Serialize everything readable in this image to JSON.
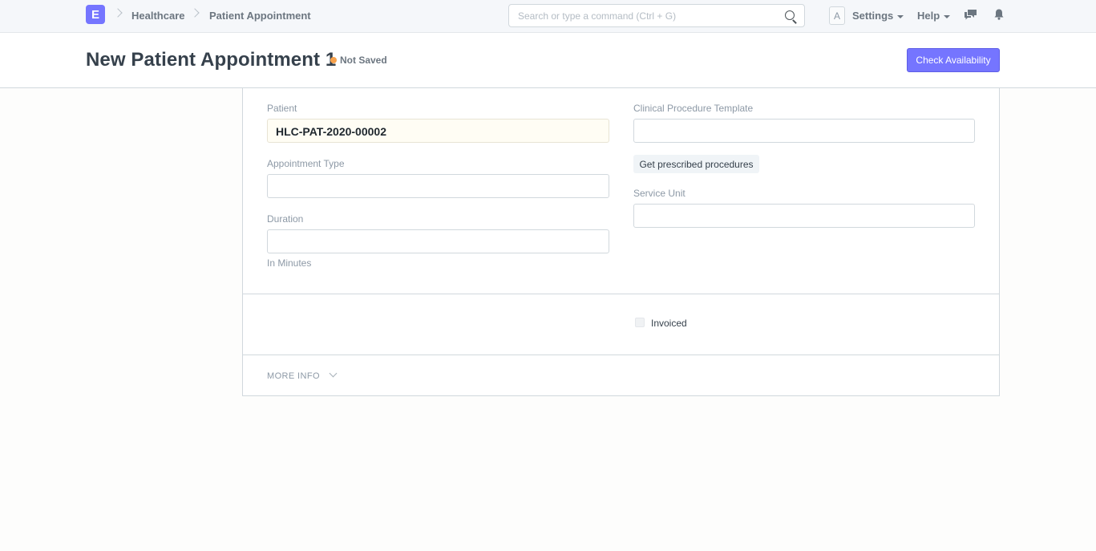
{
  "navbar": {
    "logo_letter": "E",
    "breadcrumbs": [
      "Healthcare",
      "Patient Appointment"
    ],
    "search_placeholder": "Search or type a command (Ctrl + G)",
    "avatar_letter": "A",
    "settings_label": "Settings",
    "help_label": "Help",
    "icons": [
      "search-icon",
      "chat-icon",
      "bell-icon"
    ]
  },
  "page_head": {
    "title": "New Patient Appointment 1",
    "status": "Not Saved",
    "primary_action": "Check Availability"
  },
  "form": {
    "left_column": {
      "patient": {
        "label": "Patient",
        "value": "HLC-PAT-2020-00002"
      },
      "appointment_type": {
        "label": "Appointment Type",
        "value": ""
      },
      "duration": {
        "label": "Duration",
        "value": "",
        "description": "In Minutes"
      }
    },
    "right_column": {
      "clinical_procedure_template": {
        "label": "Clinical Procedure Template",
        "value": ""
      },
      "get_prescribed_button": "Get prescribed procedures",
      "service_unit": {
        "label": "Service Unit",
        "value": ""
      }
    },
    "invoiced": {
      "label": "Invoiced",
      "checked": false
    },
    "more_info_label": "MORE INFO"
  },
  "colors": {
    "primary": "#7575ff",
    "status_dot": "#f8a24c",
    "navbar_bg": "#f5f7fa",
    "border": "#d1d8dd"
  }
}
